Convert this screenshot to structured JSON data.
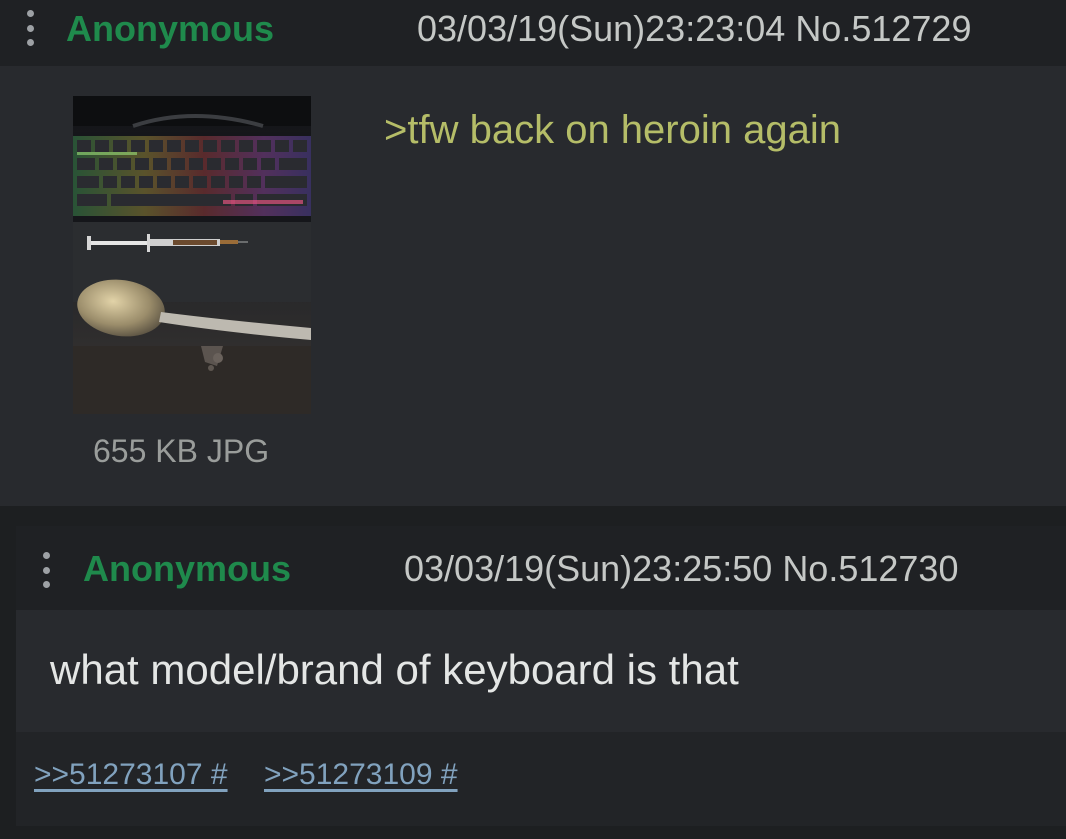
{
  "posts": [
    {
      "name": "Anonymous",
      "datetime": "03/03/19(Sun)23:23:04",
      "number": "No.512729",
      "file_info": "655 KB JPG",
      "body": ">tfw back on heroin again"
    },
    {
      "name": "Anonymous",
      "datetime": "03/03/19(Sun)23:25:50",
      "number": "No.512730",
      "body": "what model/brand of keyboard is that",
      "backlinks": [
        ">>51273107 #",
        ">>51273109 #"
      ]
    }
  ],
  "colors": {
    "name": "#1f8a4c",
    "greentext": "#b5bd68",
    "link": "#81a2be",
    "post_bg": "#282a2e",
    "header_bg": "#1f2124",
    "page_bg": "#1d1f21"
  },
  "icons": [
    "more-vertical-icon"
  ]
}
